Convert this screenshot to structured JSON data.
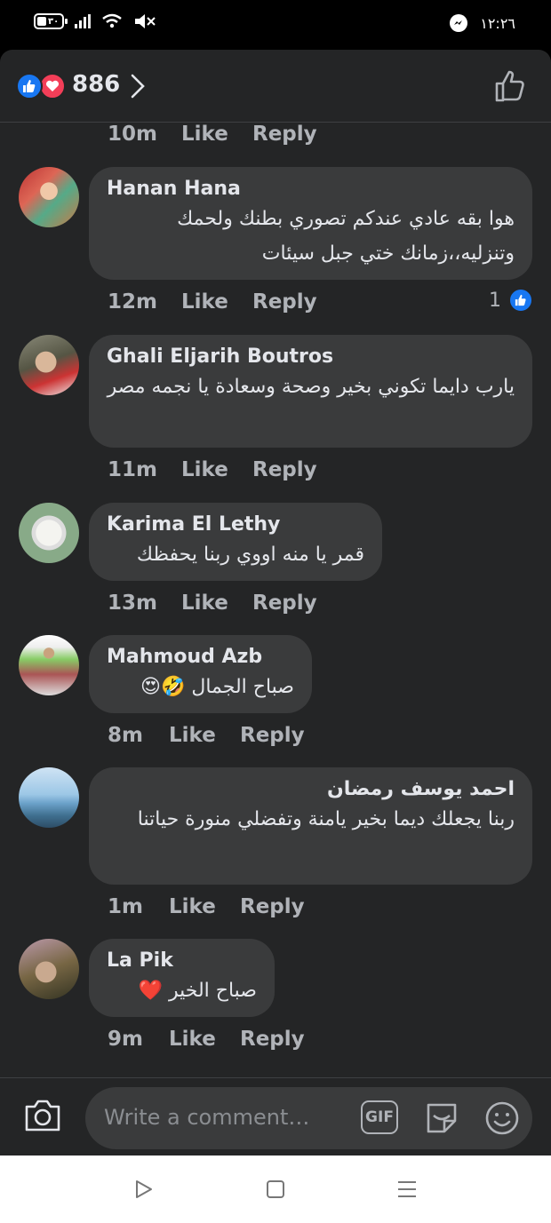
{
  "status_bar": {
    "battery": "٣٠",
    "battery_level": 0.3,
    "time": "١٢:٢٦"
  },
  "header": {
    "reaction_count": "886"
  },
  "top_actions": {
    "time": "10m",
    "like": "Like",
    "reply": "Reply"
  },
  "comments": [
    {
      "name": "Hanan Hana",
      "text": "هوا بقه عادي عندكم تصوري بطنك ولحمك وتنزليه،،زمانك ختي جبل سيئات",
      "time": "12m",
      "like": "Like",
      "reply": "Reply",
      "reactions": "1"
    },
    {
      "name": "Ghali Eljarih Boutros",
      "text": "يارب دايما تكوني بخير وصحة وسعادة يا نجمه مصر",
      "time": "11m",
      "like": "Like",
      "reply": "Reply"
    },
    {
      "name": "Karima El Lethy",
      "text": "قمر يا منه اووي ربنا يحفظك",
      "time": "13m",
      "like": "Like",
      "reply": "Reply"
    },
    {
      "name": "Mahmoud Azb",
      "text": "صباح الجمال 🤣😍",
      "time": "8m",
      "like": "Like",
      "reply": "Reply"
    },
    {
      "name": "احمد يوسف رمضان",
      "text": "ربنا يجعلك ديما بخير يامنة وتفضلي منورة حياتنا",
      "time": "1m",
      "like": "Like",
      "reply": "Reply"
    },
    {
      "name": "La Pik",
      "text": "صباح الخير ❤️",
      "time": "9m",
      "like": "Like",
      "reply": "Reply"
    }
  ],
  "composer": {
    "placeholder": "Write a comment…",
    "gif_label": "GIF"
  },
  "icons": [
    "like-reaction-icon",
    "love-reaction-icon",
    "chevron-right-icon",
    "thumbs-up-icon",
    "camera-icon",
    "gif-icon",
    "sticker-icon",
    "emoji-icon",
    "back-icon",
    "home-icon",
    "menu-icon"
  ],
  "colors": {
    "background": "#242526",
    "bubble": "#3a3b3c",
    "like_blue": "#1877f2",
    "love_red": "#f33e58",
    "muted_text": "#b0b3b8"
  }
}
